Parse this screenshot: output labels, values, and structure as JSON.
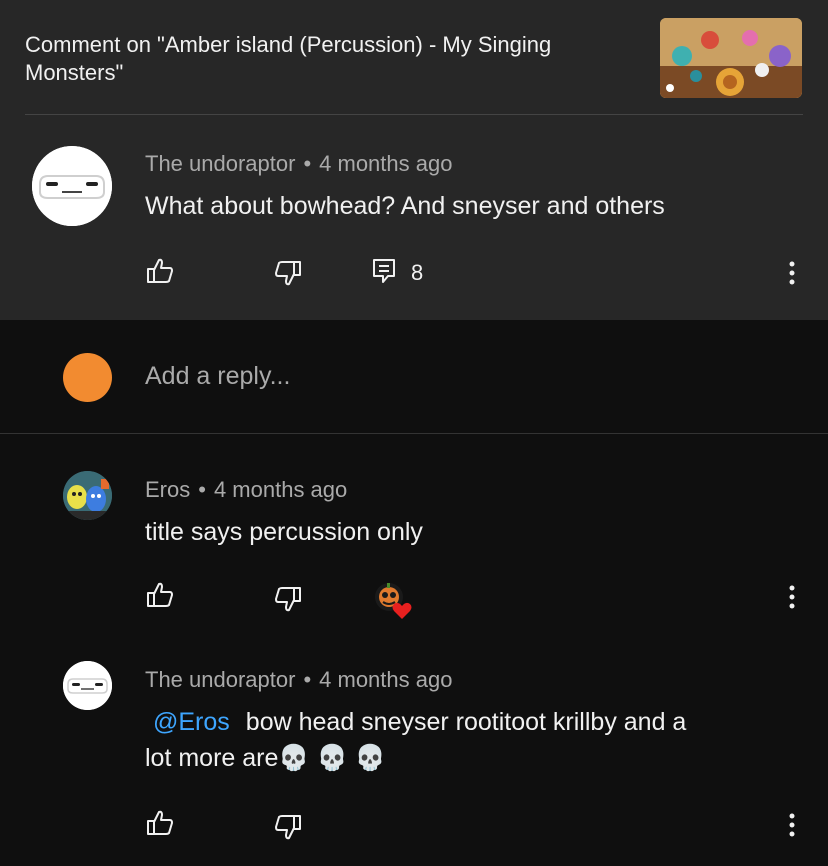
{
  "header": {
    "title": "Comment on \"Amber island (Percussion) - My Singing Monsters\""
  },
  "main_comment": {
    "author": "The undoraptor",
    "separator": "•",
    "time": "4 months ago",
    "text": "What about bowhead? And sneyser and others",
    "reply_count": "8"
  },
  "reply_box": {
    "placeholder": "Add a reply..."
  },
  "replies": [
    {
      "author": "Eros",
      "separator": "•",
      "time": "4 months ago",
      "text": "title says percussion only"
    },
    {
      "author": "The undoraptor",
      "separator": "•",
      "time": "4 months ago",
      "mention": "@Eros",
      "text_line1": "bow head sneyser rootitoot krillby and a",
      "text_line2": "lot more are",
      "emoji": "💀 💀 💀"
    }
  ],
  "colors": {
    "top_background": "#272727",
    "page_background": "#0f0f0f",
    "mention": "#3ea6ff",
    "user_avatar": "#f28b30",
    "heart": "#e8201f"
  },
  "icons": [
    "thumb-up-icon",
    "thumb-down-icon",
    "replies-icon",
    "more-vert-icon",
    "heart-icon"
  ]
}
